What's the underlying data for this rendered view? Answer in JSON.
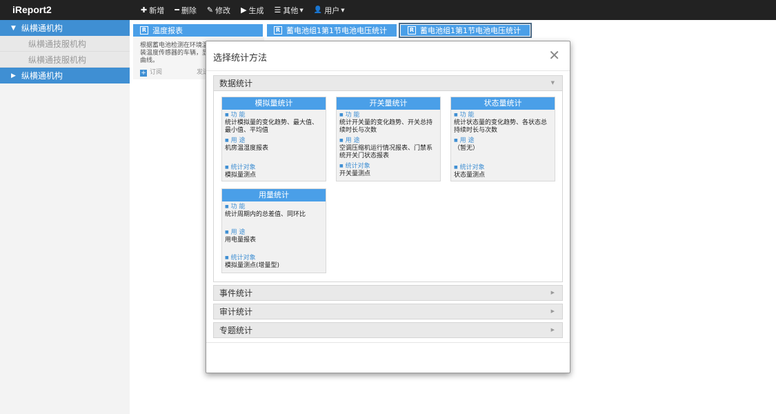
{
  "app": {
    "brand": "iReport2"
  },
  "navbar": {
    "items": [
      {
        "icon": "✚",
        "label": "新增"
      },
      {
        "icon": "━",
        "label": "删除"
      },
      {
        "icon": "✎",
        "label": "修改"
      },
      {
        "icon": "▶",
        "label": "生成"
      },
      {
        "icon": "☰",
        "label": "其他"
      },
      {
        "icon": "👤",
        "label": "用户"
      }
    ]
  },
  "sidebar": {
    "items": [
      {
        "label": "纵横通机构",
        "arrow": "▼"
      },
      {
        "label": "纵横通技服机构"
      },
      {
        "label": "纵横通技服机构"
      },
      {
        "label": "纵横通机构",
        "arrow": "▶"
      }
    ]
  },
  "reports": {
    "cards": [
      {
        "badge": "R",
        "title": "温度报表"
      },
      {
        "badge": "R",
        "title": "蓄电池组1第1节电池电压统计"
      },
      {
        "badge": "R",
        "title": "蓄电池组1第1节电池电压统计"
      }
    ],
    "first_body": {
      "line1": "根据蓄电池检测在环境温度",
      "line2": "装温度传感器的车辆，显示",
      "line3": "曲线。",
      "subscribe": "订阅",
      "send": "发送"
    }
  },
  "modal": {
    "title": "选择统计方法",
    "close": "✕",
    "sections": [
      {
        "title": "数据统计",
        "tri": "▼"
      },
      {
        "title": "事件统计",
        "tri": "▶"
      },
      {
        "title": "审计统计",
        "tri": "▶"
      },
      {
        "title": "专题统计",
        "tri": "▶"
      }
    ],
    "methods": [
      {
        "title": "模拟量统计",
        "func_label": "功  能",
        "func": "统计模拟量的变化趋势、最大值、最小值、平均值",
        "use_label": "用  途",
        "use": "机房温湿度报表",
        "obj_label": "统计对象",
        "obj": "模拟量测点"
      },
      {
        "title": "开关量统计",
        "func_label": "功  能",
        "func": "统计开关量的变化趋势、开关总持续时长与次数",
        "use_label": "用  途",
        "use": "空调压缩机运行情况报表、门禁系统开关门状态报表",
        "obj_label": "统计对象",
        "obj": "开关量测点"
      },
      {
        "title": "状态量统计",
        "func_label": "功  能",
        "func": "统计状态量的变化趋势、各状态总持续时长与次数",
        "use_label": "用  途",
        "use": "（暂无）",
        "obj_label": "统计对象",
        "obj": "状态量测点"
      },
      {
        "title": "用量统计",
        "func_label": "功  能",
        "func": "统计周期内的总差值、同环比",
        "use_label": "用  途",
        "use": "用电量报表",
        "obj_label": "统计对象",
        "obj": "模拟量测点(增量型)"
      }
    ]
  }
}
